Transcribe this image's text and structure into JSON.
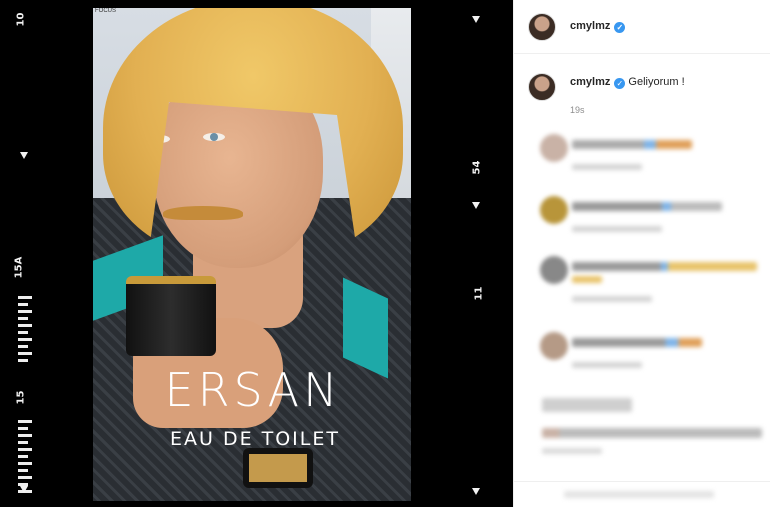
{
  "film": {
    "top_label": "10",
    "mid_label": "15A",
    "lower_label": "15",
    "right_mid_label": "54",
    "right_low_label": "11"
  },
  "photo": {
    "brand": "ERSAN",
    "subtitle": "EAU DE TOILET",
    "focus_tag": "FOCUS"
  },
  "post": {
    "username": "cmylmz",
    "verified_mark": "✓",
    "caption_username": "cmylmz",
    "caption_text": "Geliyorum !",
    "timestamp": "19s"
  },
  "colors": {
    "verified": "#3897f0",
    "accent_teal": "#1ea9a8",
    "hair": "#e2b052"
  }
}
